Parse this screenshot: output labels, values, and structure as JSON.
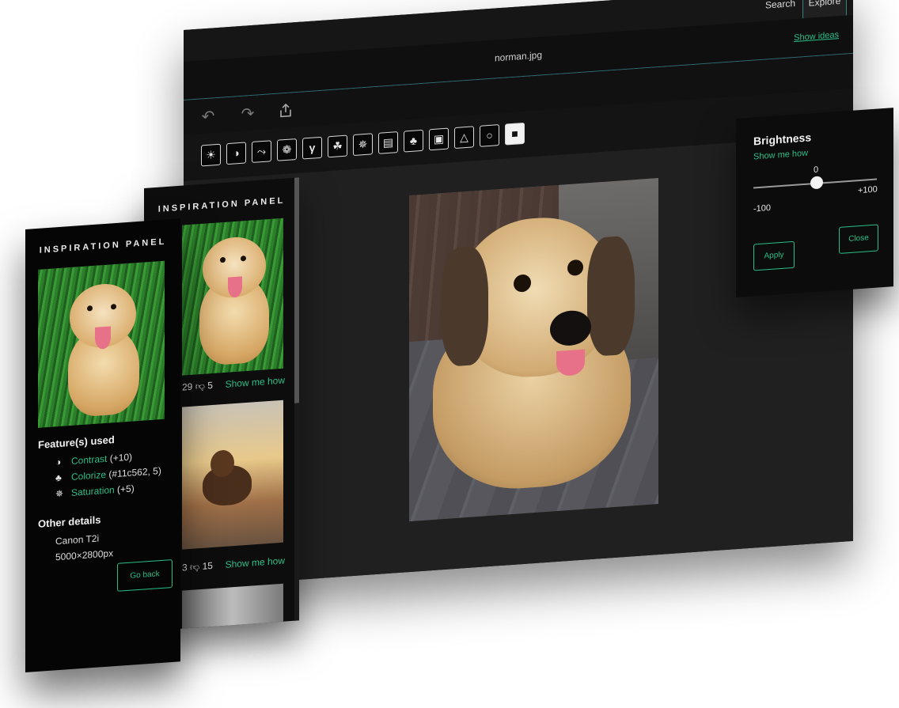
{
  "editor": {
    "tabs": [
      "Search",
      "Explore"
    ],
    "active_tab": "Explore",
    "filename": "norman.jpg",
    "show_ideas": "Show ideas",
    "toolbar_icons": [
      "undo-icon",
      "redo-icon",
      "share-icon"
    ],
    "filter_icons": [
      "brightness-icon",
      "contrast-icon",
      "curves-icon",
      "aperture-icon",
      "gamma-icon",
      "bulb-icon",
      "saturation-icon",
      "sharpen-icon",
      "colorize-icon",
      "exposure-icon",
      "triangle-icon",
      "drop-icon",
      "gradient-icon"
    ]
  },
  "brightness_panel": {
    "title": "Brightness",
    "link": "Show me how",
    "value": "0",
    "min": "-100",
    "max": "+100",
    "apply": "Apply",
    "close": "Close"
  },
  "inspiration_back": {
    "heading": "INSPIRATION PANEL",
    "items": [
      {
        "likes": "29",
        "dislikes": "5",
        "link": "Show me how"
      },
      {
        "likes": "3",
        "dislikes": "15",
        "link": "Show me how"
      }
    ]
  },
  "inspiration_front": {
    "heading": "INSPIRATION PANEL",
    "features_title": "Feature(s) used",
    "features": [
      {
        "icon": "contrast-icon",
        "name": "Contrast",
        "value": "(+10)"
      },
      {
        "icon": "colorize-icon",
        "name": "Colorize",
        "value": "(#11c562, 5)"
      },
      {
        "icon": "saturation-icon",
        "name": "Saturation",
        "value": "(+5)"
      }
    ],
    "other_title": "Other details",
    "camera": "Canon T2i",
    "dimensions": "5000×2800px",
    "go_back": "Go back"
  },
  "colors": {
    "accent": "#2bbf88",
    "panel_bg": "#0c0c0c",
    "editor_bg": "#202020",
    "divider": "#2f6f78"
  }
}
